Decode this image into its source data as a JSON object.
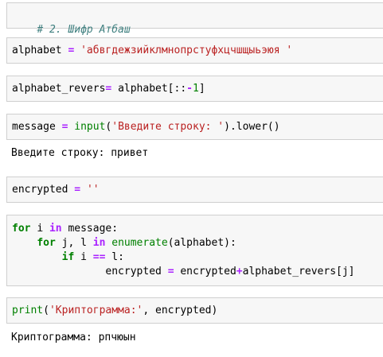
{
  "colors": {
    "cell_background": "#f7f7f7",
    "cell_border": "#cfcfcf",
    "comment": "#408080",
    "string": "#ba2121",
    "operator": "#aa22ff",
    "keyword": "#008000",
    "number": "#008000"
  },
  "cells": [
    {
      "comment": "# 2. Шифр Атбаш"
    },
    {
      "var": "alphabet",
      "op": "=",
      "string": "'абвгдежзийклмнопрстуфхцчшщыьэюя '"
    },
    {
      "var": "alphabet_revers",
      "op": "=",
      "source": "alphabet[::",
      "minus": "-",
      "num": "1",
      "close": "]"
    },
    {
      "var": "message",
      "op": "=",
      "func": "input",
      "open": "(",
      "string": "'Введите строку: '",
      "tail": ").lower()",
      "output": "Введите строку: привет"
    },
    {
      "var": "encrypted",
      "op": "=",
      "string": "''"
    },
    {
      "kw_for": "for",
      "kw_in": "in",
      "kw_if": "if",
      "op_eq": "==",
      "line1_a": "i",
      "line1_b": "message:",
      "line2_a": "j, l",
      "func": "enumerate",
      "line2_b": "(alphabet):",
      "line3_a": "i",
      "line3_b": "l:",
      "line4_a": "encrypted",
      "line4_b": "encrypted",
      "op_plus": "+",
      "line4_c": "alphabet_revers[j]"
    },
    {
      "func": "print",
      "open": "(",
      "string": "'Криптограмма:'",
      "tail": ", encrypted)",
      "output": "Криптограмма: рпчюын"
    }
  ]
}
